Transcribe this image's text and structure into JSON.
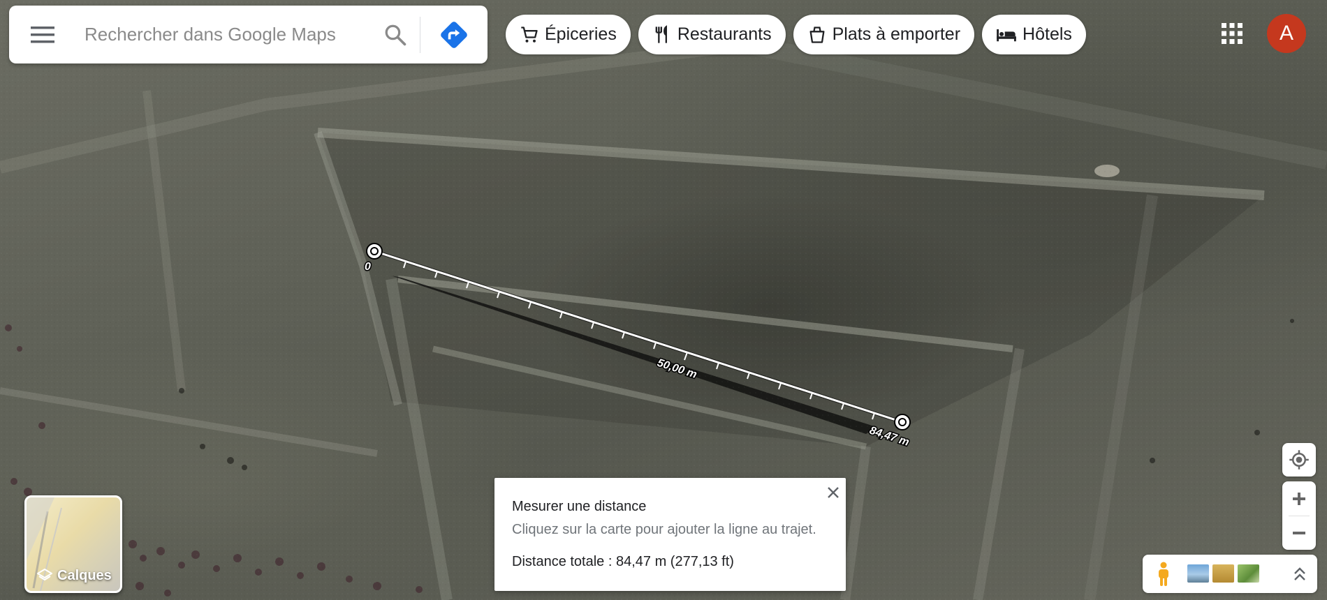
{
  "search": {
    "placeholder": "Rechercher dans Google Maps"
  },
  "icons": {
    "menu": "menu-icon",
    "search": "search-icon",
    "directions": "directions-icon",
    "grocery": "shopping-cart-icon",
    "restaurants": "fork-knife-icon",
    "takeout": "takeout-bag-icon",
    "hotels": "bed-icon",
    "apps": "apps-grid-icon",
    "layers": "layers-icon",
    "close": "close-icon",
    "location": "my-location-icon",
    "zoom_in": "plus-icon",
    "zoom_out": "minus-icon",
    "pegman": "pegman-icon",
    "expand": "double-chevron-up-icon"
  },
  "chips": [
    {
      "label": "Épiceries"
    },
    {
      "label": "Restaurants"
    },
    {
      "label": "Plats à emporter"
    },
    {
      "label": "Hôtels"
    }
  ],
  "account": {
    "avatar_letter": "A",
    "avatar_color": "#c5381e"
  },
  "layers": {
    "label": "Calques"
  },
  "measure": {
    "start_label": "0",
    "mid_label": "50,00 m",
    "end_label": "84,47 m",
    "title": "Mesurer une distance",
    "hint": "Cliquez sur la carte pour ajouter la ligne au trajet.",
    "total": "Distance totale : 84,47 m (277,13 ft)"
  },
  "colors": {
    "accent": "#1a73e8",
    "text": "#202124",
    "muted": "#70757a"
  }
}
